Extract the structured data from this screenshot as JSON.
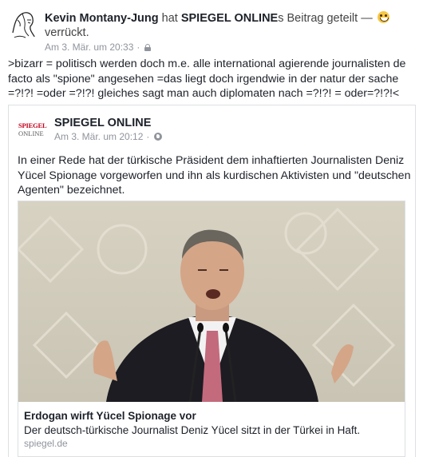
{
  "post": {
    "author": "Kevin Montany-Jung",
    "hat_text": "hat",
    "shared_page": "SPIEGEL ONLINE",
    "shared_suffix": "s Beitrag geteilt —",
    "feeling_emoji": "crazy-face-emoji",
    "feeling": "verrückt.",
    "timestamp": "Am 3. Mär. um 20:33",
    "separator": "·",
    "privacy_icon": "lock-icon",
    "text": ">bizarr = politisch werden doch m.e. alle international agierende journalisten  de facto als \"spione\" angesehen =das liegt doch irgendwie in der natur der sache =?!?! =oder =?!?! gleiches sagt man auch diplomaten nach =?!?! = oder=?!?!<"
  },
  "shared_post": {
    "logo_line1": "SPIEGEL",
    "logo_line2": "ONLINE",
    "page_name": "SPIEGEL ONLINE",
    "timestamp": "Am 3. Mär. um 20:12",
    "separator": "·",
    "privacy_icon": "globe-icon",
    "text": "In einer Rede hat der türkische Präsident dem inhaftierten Journalisten Deniz Yücel Spionage vorgeworfen und ihn als kurdischen Aktivisten und \"deutschen Agenten\" bezeichnet."
  },
  "link_card": {
    "title": "Erdogan wirft Yücel Spionage vor",
    "description": "Der deutsch-türkische Journalist Deniz Yücel sitzt in der Türkei in Haft.",
    "domain": "spiegel.de"
  },
  "colors": {
    "text": "#1d2129",
    "meta": "#90949c",
    "spiegel_red": "#c2001b",
    "border": "#dddfe2"
  }
}
